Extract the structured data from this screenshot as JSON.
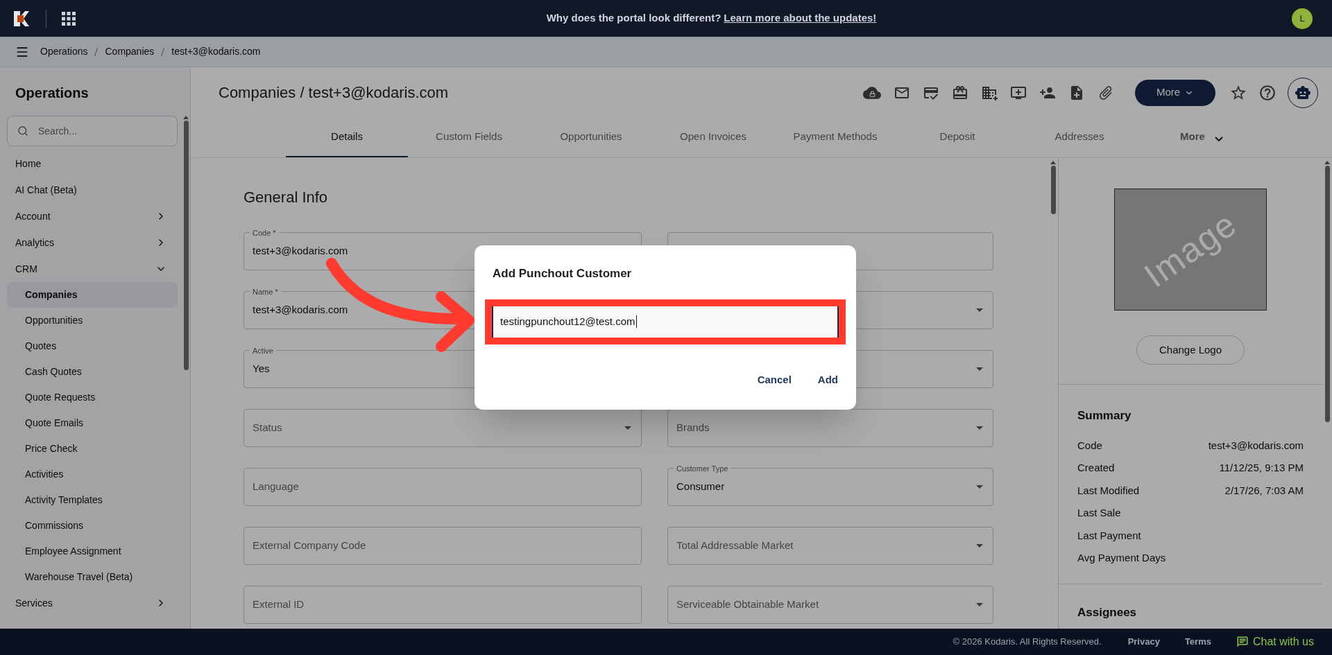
{
  "banner": {
    "question": "Why does the portal look different?",
    "link": "Learn more about the updates!"
  },
  "user": {
    "initial": "L"
  },
  "breadcrumb": [
    "Operations",
    "Companies",
    "test+3@kodaris.com"
  ],
  "sidebar": {
    "title": "Operations",
    "search": {
      "placeholder": "Search..."
    },
    "items": [
      {
        "label": "Home"
      },
      {
        "label": "AI Chat (Beta)"
      },
      {
        "label": "Account",
        "expanded": false
      },
      {
        "label": "Analytics",
        "expanded": false
      },
      {
        "label": "CRM",
        "expanded": true,
        "children": [
          {
            "label": "Companies",
            "selected": true
          },
          {
            "label": "Opportunities",
            "selected": false
          },
          {
            "label": "Quotes",
            "selected": false
          },
          {
            "label": "Cash Quotes",
            "selected": false
          },
          {
            "label": "Quote Requests",
            "selected": false
          },
          {
            "label": "Quote Emails",
            "selected": false
          },
          {
            "label": "Price Check",
            "selected": false
          },
          {
            "label": "Activities",
            "selected": false
          },
          {
            "label": "Activity Templates",
            "selected": false
          },
          {
            "label": "Commissions",
            "selected": false
          },
          {
            "label": "Employee Assignment",
            "selected": false
          },
          {
            "label": "Warehouse Travel (Beta)",
            "selected": false
          }
        ]
      },
      {
        "label": "Services",
        "expanded": false
      }
    ]
  },
  "page": {
    "title": "Companies / test+3@kodaris.com",
    "more_button": "More"
  },
  "tabs": [
    {
      "label": "Details",
      "selected": true
    },
    {
      "label": "Custom Fields",
      "selected": false
    },
    {
      "label": "Opportunities",
      "selected": false
    },
    {
      "label": "Open Invoices",
      "selected": false
    },
    {
      "label": "Payment Methods",
      "selected": false
    },
    {
      "label": "Deposit",
      "selected": false
    },
    {
      "label": "Addresses",
      "selected": false
    },
    {
      "label": "More",
      "selected": false,
      "kind": "menu"
    }
  ],
  "section_title": "General Info",
  "field_rows": [
    [
      {
        "kind": "text",
        "label": "Code *",
        "value": "test+3@kodaris.com"
      },
      {
        "kind": "text"
      }
    ],
    [
      {
        "kind": "text",
        "label": "Name *",
        "value": "test+3@kodaris.com"
      },
      {
        "kind": "select"
      }
    ],
    [
      {
        "kind": "select",
        "label": "Active",
        "value": "Yes"
      },
      {
        "kind": "select"
      }
    ],
    [
      {
        "kind": "select",
        "placeholder": "Status"
      },
      {
        "kind": "select",
        "placeholder": "Brands"
      }
    ],
    [
      {
        "kind": "text",
        "placeholder": "Language"
      },
      {
        "kind": "select",
        "label": "Customer Type",
        "value": "Consumer"
      }
    ],
    [
      {
        "kind": "text",
        "placeholder": "External Company Code"
      },
      {
        "kind": "select",
        "placeholder": "Total Addressable Market"
      }
    ],
    [
      {
        "kind": "text",
        "placeholder": "External ID"
      },
      {
        "kind": "select",
        "placeholder": "Serviceable Obtainable Market"
      }
    ]
  ],
  "logo": {
    "placeholder_text": "Image",
    "button": "Change Logo"
  },
  "summary": {
    "title": "Summary",
    "rows": [
      {
        "label": "Code",
        "value": "test+3@kodaris.com"
      },
      {
        "label": "Created",
        "value": "11/12/25, 9:13 PM"
      },
      {
        "label": "Last Modified",
        "value": "2/17/26, 7:03 AM"
      },
      {
        "label": "Last Sale"
      },
      {
        "label": "Last Payment"
      },
      {
        "label": "Avg Payment Days"
      }
    ]
  },
  "assignees_title": "Assignees",
  "dialog": {
    "title": "Add Punchout Customer",
    "value": "testingpunchout12@test.com",
    "buttons": [
      "Cancel",
      "Add"
    ]
  },
  "footer": {
    "copyright": "© 2026 Kodaris. All Rights Reserved.",
    "links": [
      "Privacy",
      "Terms"
    ],
    "chat": "Chat with us"
  }
}
